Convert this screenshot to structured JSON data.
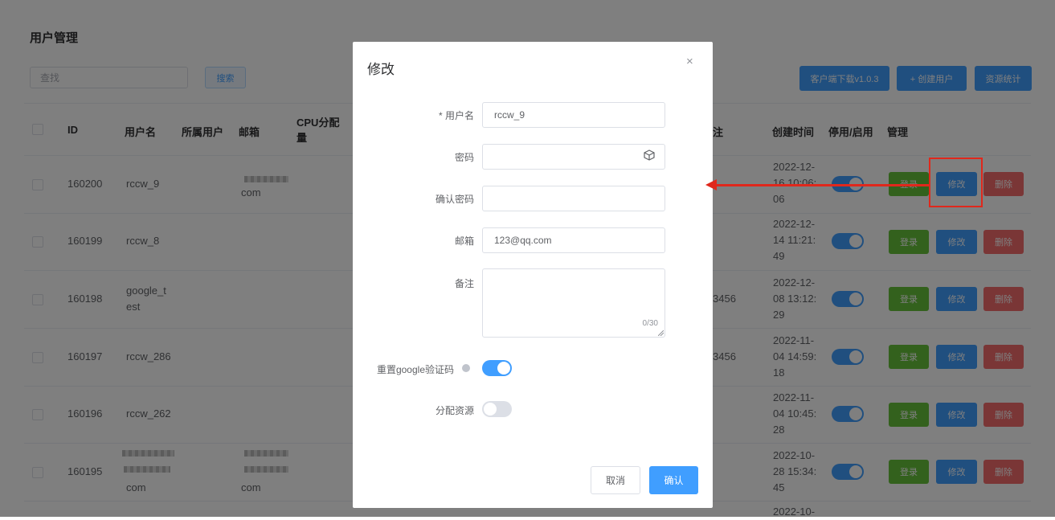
{
  "page": {
    "title": "用户管理",
    "search": {
      "placeholder": "查找",
      "button": "搜索"
    },
    "toolbar": {
      "download": "客户端下载v1.0.3",
      "create": "+ 创建用户",
      "stats": "资源统计"
    }
  },
  "table": {
    "headers": {
      "id": "ID",
      "username": "用户名",
      "owner": "所属用户",
      "email": "邮箱",
      "cpu": "CPU分配量",
      "remark": "注",
      "created": "创建时间",
      "enable": "停用/启用",
      "manage": "管理"
    },
    "actions": {
      "login": "登录",
      "edit": "修改",
      "delete": "删除"
    },
    "rows": [
      {
        "id": "160200",
        "username": "rccw_9",
        "email": "com",
        "remark": "",
        "created": "2022-12-16 10:06:06",
        "created_lines": [
          "2022-12-",
          "16 10:06:",
          "06"
        ],
        "enabled": true
      },
      {
        "id": "160199",
        "username": "rccw_8",
        "email": "",
        "remark": "",
        "created": "2022-12-14 11:21:49",
        "created_lines": [
          "2022-12-",
          "14 11:21:",
          "49"
        ],
        "enabled": true
      },
      {
        "id": "160198",
        "username_lines": [
          "google_t",
          "est"
        ],
        "email": "",
        "remark": "3456",
        "created": "2022-12-08 13:12:29",
        "created_lines": [
          "2022-12-",
          "08 13:12:",
          "29"
        ],
        "enabled": true
      },
      {
        "id": "160197",
        "username": "rccw_286",
        "email": "",
        "remark": "3456",
        "created": "2022-11-04 14:59:18",
        "created_lines": [
          "2022-11-",
          "04 14:59:",
          "18"
        ],
        "enabled": true
      },
      {
        "id": "160196",
        "username": "rccw_262",
        "email": "",
        "remark": "",
        "created": "2022-11-04 10:45:28",
        "created_lines": [
          "2022-11-",
          "04 10:45:",
          "28"
        ],
        "enabled": true
      },
      {
        "id": "160195",
        "username": "com",
        "email": "com",
        "remark": "",
        "created": "2022-10-28 15:34:45",
        "created_lines": [
          "2022-10-",
          "28 15:34:",
          "45"
        ],
        "enabled": true
      }
    ],
    "partial_row_created": "2022-10-"
  },
  "dialog": {
    "title": "修改",
    "close": "×",
    "fields": {
      "username": {
        "label": "* 用户名",
        "value": "rccw_9"
      },
      "password": {
        "label": "密码",
        "value": ""
      },
      "confirm_password": {
        "label": "确认密码",
        "value": ""
      },
      "email": {
        "label": "邮箱",
        "value": "123@qq.com"
      },
      "remark": {
        "label": "备注",
        "value": "",
        "counter": "0/30"
      },
      "reset_google": {
        "label": "重置google验证码",
        "enabled": true
      },
      "allocate": {
        "label": "分配资源",
        "enabled": false
      }
    },
    "cancel": "取消",
    "confirm": "确认"
  },
  "colors": {
    "primary": "#409eff",
    "success": "#67c23a",
    "danger": "#f56c6c",
    "annotation": "#e0281c"
  }
}
